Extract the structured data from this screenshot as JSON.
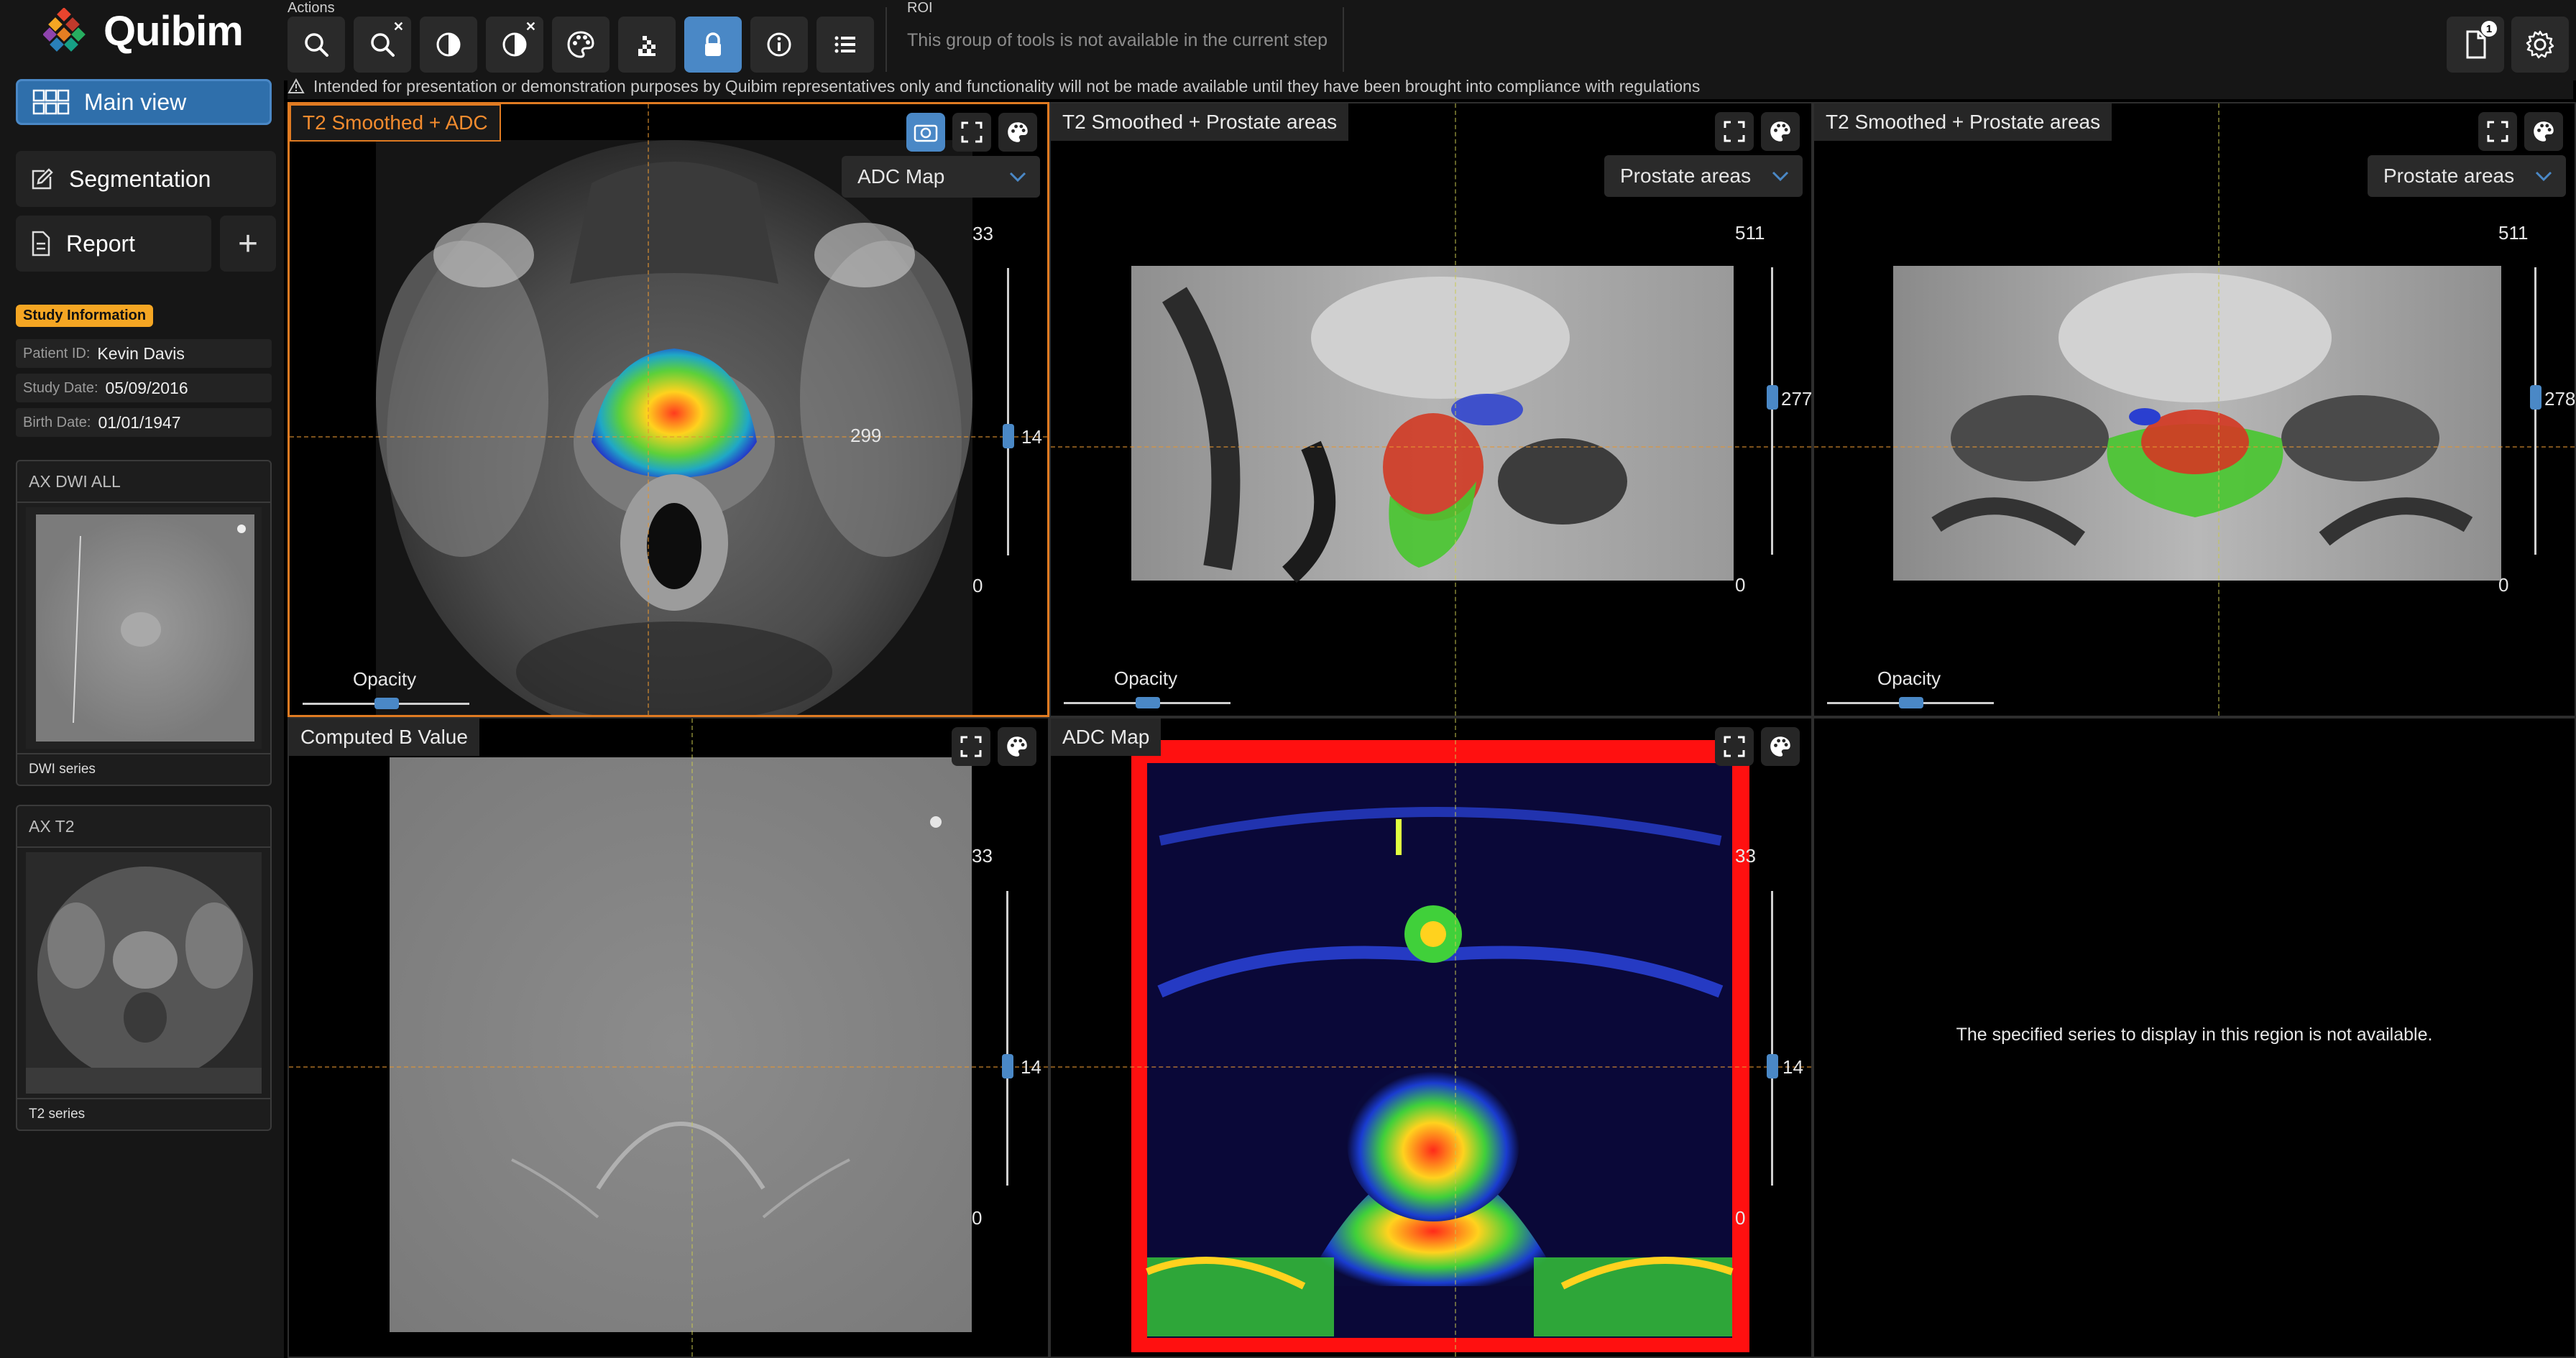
{
  "app": {
    "name": "Quibim"
  },
  "header": {
    "actions_label": "Actions",
    "roi_label": "ROI",
    "roi_message": "This group of tools is not available in the current step",
    "tools": [
      {
        "name": "zoom-icon",
        "active": false
      },
      {
        "name": "reset-zoom-icon",
        "active": false
      },
      {
        "name": "contrast-icon",
        "active": false
      },
      {
        "name": "reset-contrast-icon",
        "active": false
      },
      {
        "name": "palette-icon",
        "active": false
      },
      {
        "name": "pixel-grid-icon",
        "active": false
      },
      {
        "name": "lock-icon",
        "active": true
      },
      {
        "name": "info-icon",
        "active": false
      },
      {
        "name": "list-icon",
        "active": false
      }
    ],
    "document_badge": "1",
    "disclaimer": "Intended for presentation or demonstration purposes by Quibim representatives only and functionality will not be made available until they have been brought into compliance with regulations"
  },
  "sidebar": {
    "main_view": "Main view",
    "segmentation": "Segmentation",
    "report": "Report",
    "add": "+",
    "study_tag": "Study Information",
    "patient_id_key": "Patient ID:",
    "patient_id": "Kevin Davis",
    "study_date_key": "Study Date:",
    "study_date": "05/09/2016",
    "birth_date_key": "Birth Date:",
    "birth_date": "01/01/1947",
    "series": [
      {
        "title": "AX DWI ALL",
        "footer": "DWI series"
      },
      {
        "title": "AX T2",
        "footer": "T2 series"
      }
    ]
  },
  "viewports": {
    "v1": {
      "title": "T2 Smoothed + ADC",
      "dropdown": "ADC Map",
      "scale_top": "33",
      "scale_bottom": "0",
      "slice": "14",
      "center_value": "299",
      "opacity_label": "Opacity",
      "opacity": 0.5
    },
    "v2": {
      "title": "T2 Smoothed + Prostate areas",
      "dropdown": "Prostate areas",
      "scale_top": "511",
      "scale_bottom": "0",
      "slice": "277",
      "opacity_label": "Opacity",
      "opacity": 0.5
    },
    "v3": {
      "title": "T2 Smoothed + Prostate areas",
      "dropdown": "Prostate areas",
      "scale_top": "511",
      "scale_bottom": "0",
      "slice": "278",
      "opacity_label": "Opacity",
      "opacity": 0.5
    },
    "v4": {
      "title": "Computed B Value",
      "scale_top": "33",
      "scale_bottom": "0",
      "slice": "14"
    },
    "v5": {
      "title": "ADC Map",
      "scale_top": "33",
      "scale_bottom": "0",
      "slice": "14"
    },
    "v6": {
      "message": "The specified series to display in this region is not available."
    }
  },
  "colors": {
    "accent": "#4a88c6",
    "selected_border": "#e07b22",
    "study_tag": "#f5a623"
  }
}
